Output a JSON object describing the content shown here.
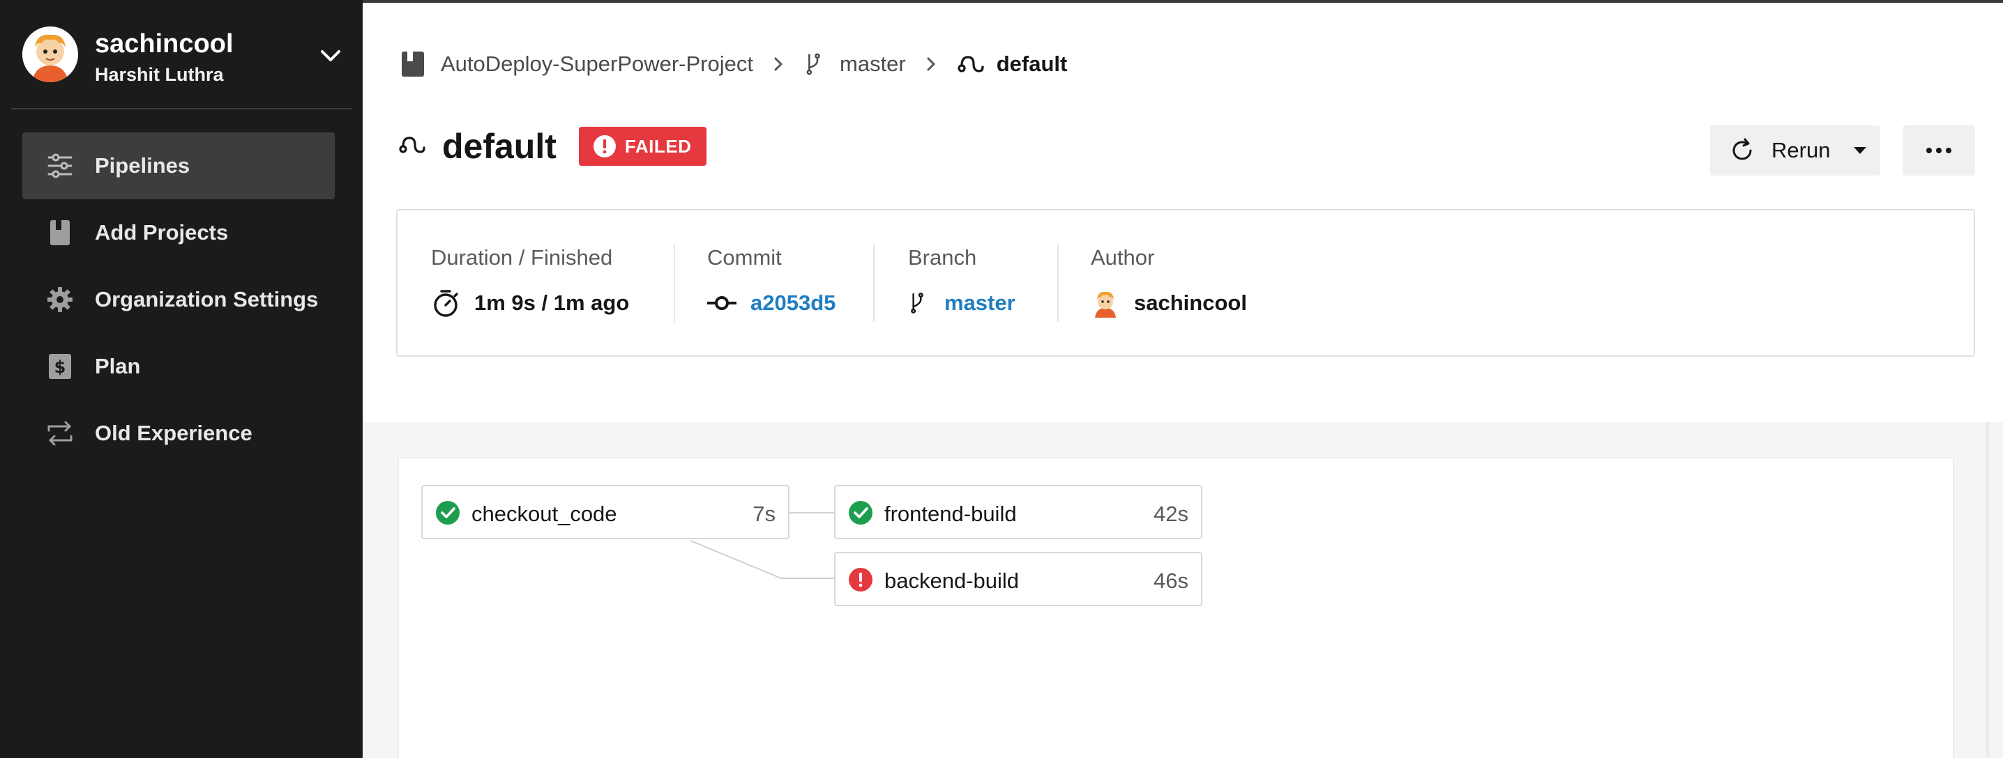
{
  "user": {
    "username": "sachincool",
    "full_name": "Harshit Luthra"
  },
  "sidebar": {
    "items": [
      {
        "label": "Pipelines",
        "icon": "pipelines-icon",
        "active": true
      },
      {
        "label": "Add Projects",
        "icon": "book-icon",
        "active": false
      },
      {
        "label": "Organization Settings",
        "icon": "gear-icon",
        "active": false
      },
      {
        "label": "Plan",
        "icon": "dollar-icon",
        "active": false
      },
      {
        "label": "Old Experience",
        "icon": "switch-arrows-icon",
        "active": false
      }
    ]
  },
  "breadcrumb": {
    "project": "AutoDeploy-SuperPower-Project",
    "branch": "master",
    "workflow": "default"
  },
  "header": {
    "title": "default",
    "status": "FAILED",
    "status_color": "#e5383f",
    "rerun_label": "Rerun"
  },
  "info": {
    "duration_label": "Duration / Finished",
    "duration_value": "1m 9s / 1m ago",
    "commit_label": "Commit",
    "commit_value": "a2053d5",
    "branch_label": "Branch",
    "branch_value": "master",
    "author_label": "Author",
    "author_value": "sachincool",
    "link_color": "#1f7ec1"
  },
  "jobs": [
    {
      "name": "checkout_code",
      "duration": "7s",
      "status": "success"
    },
    {
      "name": "frontend-build",
      "duration": "42s",
      "status": "success"
    },
    {
      "name": "backend-build",
      "duration": "46s",
      "status": "failed"
    }
  ],
  "colors": {
    "success": "#1d9e4f",
    "failed": "#e5383f",
    "sidebar_bg": "#1b1b1b"
  }
}
